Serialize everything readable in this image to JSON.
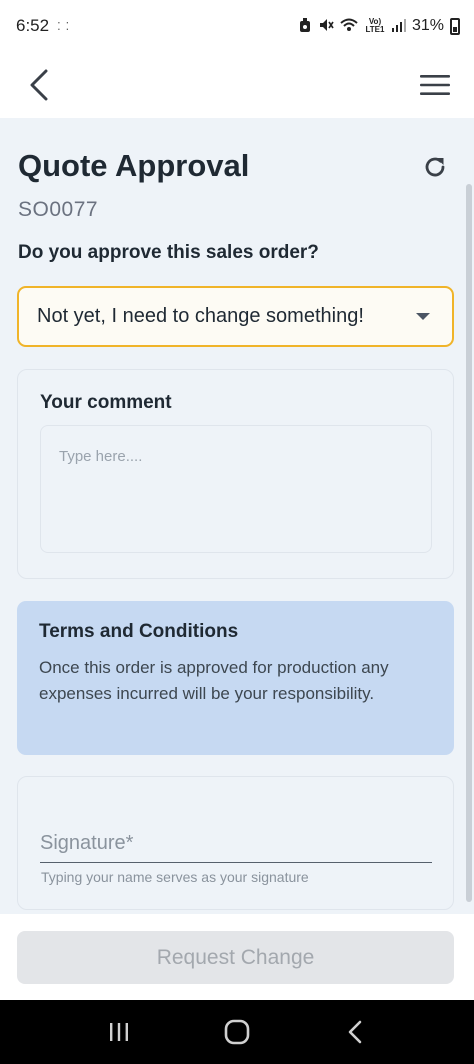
{
  "status_bar": {
    "time": "6:52",
    "extra": "⁚ ⁚",
    "network": "Vo) LTE1",
    "battery": "31%"
  },
  "header": {
    "back_icon": "chevron-left-icon",
    "menu_icon": "hamburger-menu-icon"
  },
  "page": {
    "title": "Quote Approval",
    "order_id": "SO0077",
    "refresh_icon": "refresh-icon",
    "question": "Do you approve this sales order?"
  },
  "approval_select": {
    "selected": "Not yet, I need to change something!",
    "border_color": "#f0b429"
  },
  "comment": {
    "label": "Your comment",
    "placeholder": "Type here...."
  },
  "terms": {
    "title": "Terms and Conditions",
    "body": "Once this order is approved for production any expenses incurred will be your responsibility.",
    "background": "#c6d9f2"
  },
  "signature": {
    "placeholder": "Signature*",
    "hint": "Typing your name serves as your signature"
  },
  "actions": {
    "request_change": "Request Change"
  },
  "nav_bar": {
    "recents_icon": "recents-icon",
    "home_icon": "home-icon",
    "back_icon": "back-icon"
  }
}
